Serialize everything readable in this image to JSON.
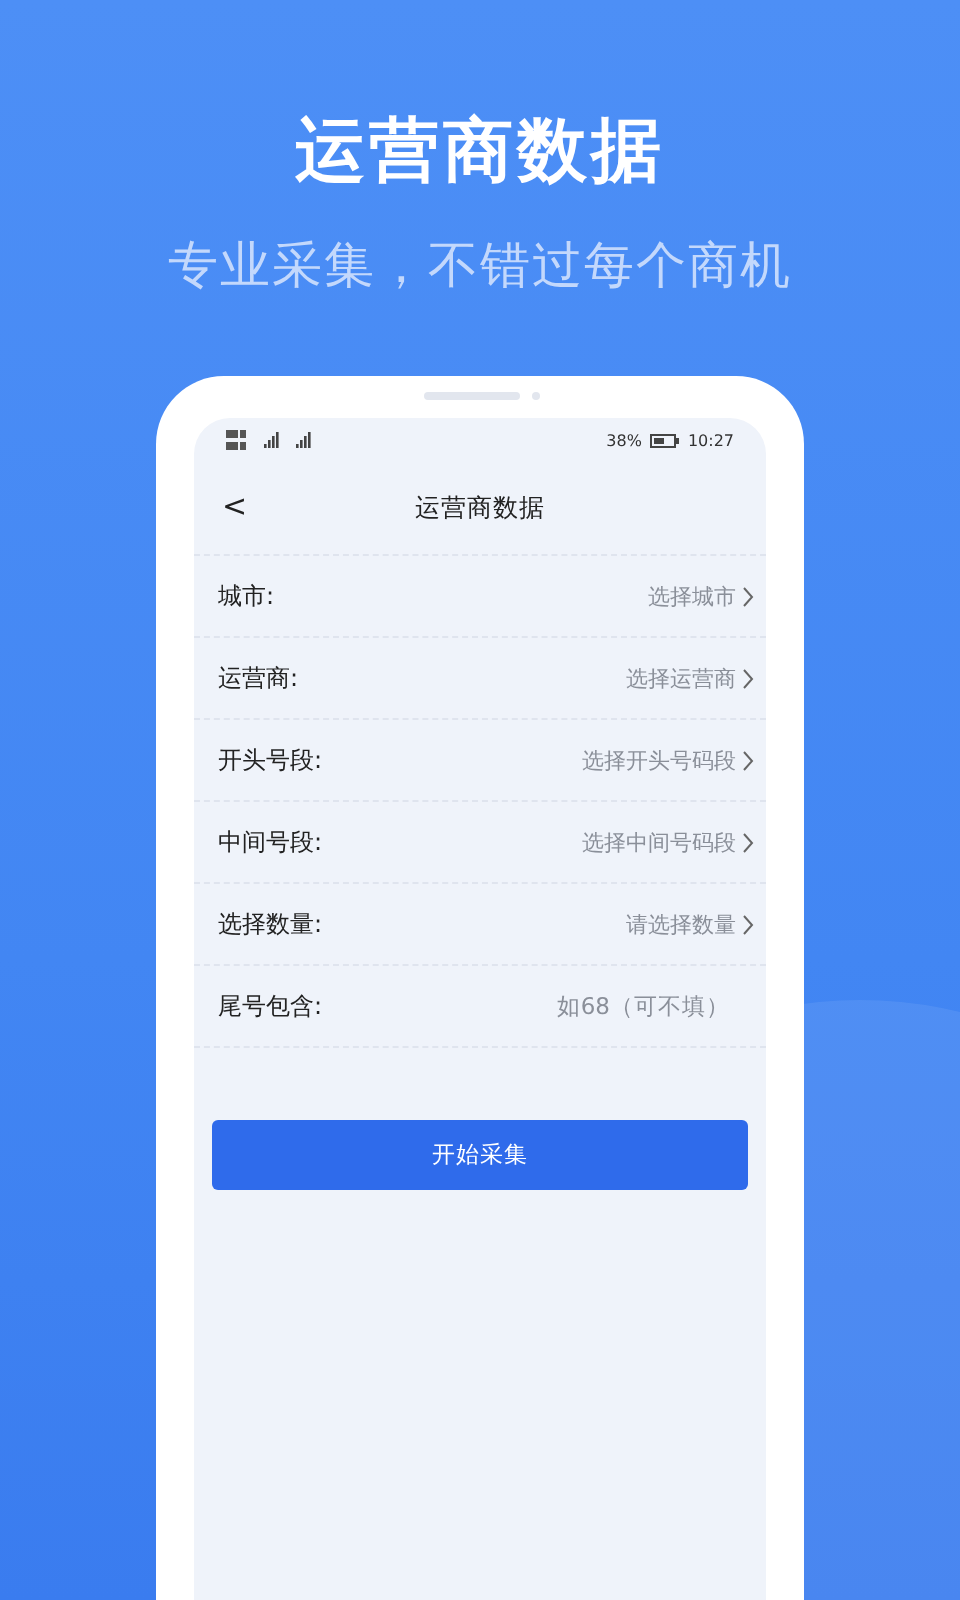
{
  "headline": "运营商数据",
  "tagline": "专业采集，不错过每个商机",
  "status_bar": {
    "battery": "38%",
    "time": "10:27"
  },
  "nav": {
    "back": "<",
    "title": "运营商数据"
  },
  "fields": [
    {
      "kind": "select",
      "label": "城市:",
      "placeholder": "选择城市"
    },
    {
      "kind": "select",
      "label": "运营商:",
      "placeholder": "选择运营商"
    },
    {
      "kind": "select",
      "label": "开头号段:",
      "placeholder": "选择开头号码段"
    },
    {
      "kind": "select",
      "label": "中间号段:",
      "placeholder": "选择中间号码段"
    },
    {
      "kind": "select",
      "label": "选择数量:",
      "placeholder": "请选择数量"
    },
    {
      "kind": "input",
      "label": "尾号包含:",
      "placeholder": "如68（可不填）"
    }
  ],
  "button": "开始采集"
}
